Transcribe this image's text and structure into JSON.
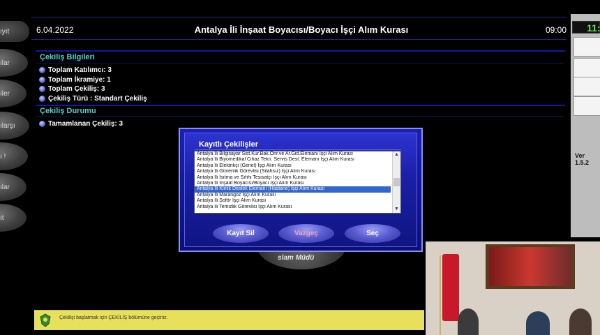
{
  "nav": {
    "items": [
      "ıyıt",
      "ılar",
      "ıler",
      "ılarşı",
      "ı !",
      "ılar",
      "ıt"
    ]
  },
  "header": {
    "date": "6.04.2022",
    "title": "Antalya İli İnşaat Boyacısı/Boyacı İşçi Alım Kurası",
    "time": "09:00"
  },
  "cekilis_bilgileri": {
    "title": "Çekiliş Bilgileri",
    "rows": [
      "Toplam Katılımcı: 3",
      "Toplam İkramiye: 1",
      "Toplam Çekiliş: 3",
      "Çekiliş Türü :  Standart Çekiliş"
    ]
  },
  "cekilis_durumu": {
    "title": "Çekiliş Durumu",
    "rows": [
      "Tamamlanan Çekiliş: 3"
    ]
  },
  "right_panel": {
    "clock": "11:",
    "version": "Ver 1.5.2"
  },
  "dialog": {
    "title": "Kayıtlı Çekilişler",
    "items": [
      "Antalya İli Bilgisayar Sist.Kur.Bak.Onr.ve Ar.Gid.Elemanı İşçi Alım Kurası",
      "Antalya İli Biyomedikal Cihaz Tekn. Servis Dest. Elemanı İşçi Alım Kurası",
      "Antalya İli Elektrikçi (Genel) İşçi Alım Kurası",
      "Antalya İli Güvenlik Görevlisi (Silahsız) İşçi Alım Kurası",
      "Antalya İli Isıtma ve Sıhhi Tesisatçı İşçi Alım Kurası",
      "Antalya İli İnşaat Boyacısı/Boyacı İşçi Alım Kurası",
      "Antalya İli Klinik Destek Elemanı (Hastane) İşçi Alım Kurası",
      "Antalya İli Marangoz İşçi Alım Kurası",
      "Antalya İli Şoför İşçi Alım Kurası",
      "Antalya İli Temizlik Görevlisi İşçi Alım Kurası"
    ],
    "selected_index": 6,
    "buttons": {
      "delete": "Kayıt Sil",
      "cancel": "Vazgeç",
      "select": "Seç"
    }
  },
  "emblem_text": "slam Müdü",
  "status": {
    "message": "Çekilişi başlatmak için ÇEKİLİŞ bölümüne geçiniz."
  },
  "colors": {
    "section_title": "#4ed1d1",
    "dialog_blue": "#1c1fb8",
    "status_bar": "#e8e05a",
    "clock_green": "#57e84a"
  }
}
